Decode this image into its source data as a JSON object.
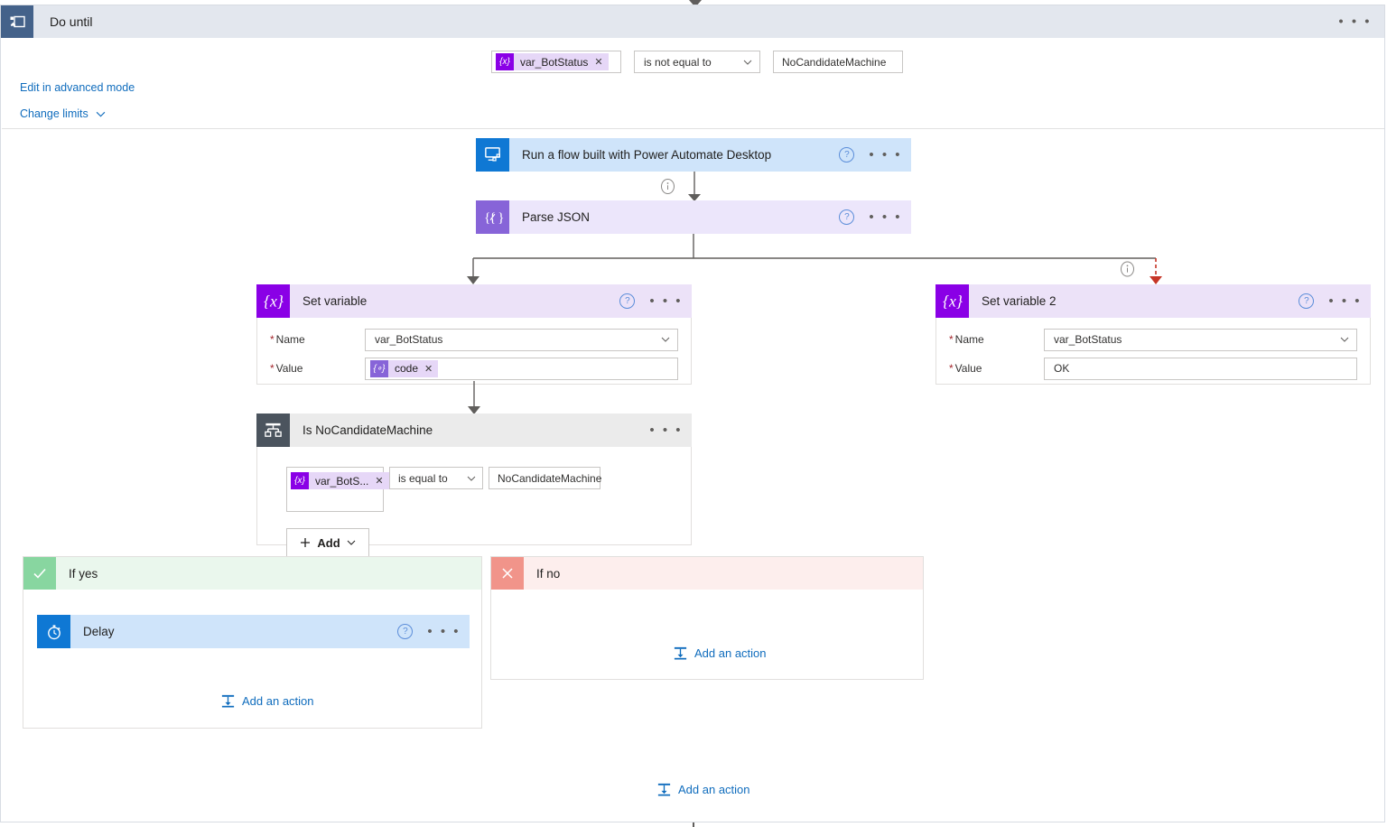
{
  "scope": {
    "title": "Do until",
    "icon": "do-until-icon",
    "menu": "• • •",
    "condition": {
      "token": {
        "label": "var_BotStatus",
        "chip": "{x}",
        "remove": "✕"
      },
      "operator": "is not equal to",
      "value": "NoCandidateMachine"
    },
    "links": {
      "advanced": "Edit in advanced mode",
      "limits": "Change limits"
    }
  },
  "actions": {
    "run_flow": {
      "title": "Run a flow built with Power Automate Desktop",
      "icon": "desktop-flow-icon",
      "help": "?",
      "menu": "• • •"
    },
    "parse_json": {
      "title": "Parse JSON",
      "icon": "expression-icon",
      "help": "?",
      "menu": "• • •"
    },
    "set_variable": {
      "title": "Set variable",
      "icon": "variable-icon",
      "help": "?",
      "menu": "• • •",
      "fields": [
        {
          "label": "Name",
          "required": true,
          "value": "var_BotStatus",
          "type": "dropdown"
        },
        {
          "label": "Value",
          "required": true,
          "value": "",
          "type": "token",
          "token": "code",
          "token_chip": "{∘}",
          "token_remove": "✕"
        }
      ]
    },
    "set_variable_2": {
      "title": "Set variable 2",
      "icon": "variable-icon",
      "help": "?",
      "menu": "• • •",
      "fields": [
        {
          "label": "Name",
          "required": true,
          "value": "var_BotStatus",
          "type": "dropdown"
        },
        {
          "label": "Value",
          "required": true,
          "value": "OK",
          "type": "text"
        }
      ]
    },
    "condition": {
      "title": "Is NoCandidateMachine",
      "icon": "condition-icon",
      "menu": "• • •",
      "row": {
        "token": {
          "label": "var_BotS...",
          "chip": "{x}",
          "remove": "✕"
        },
        "operator": "is equal to",
        "value": "NoCandidateMachine"
      },
      "add_label": "Add"
    },
    "delay": {
      "title": "Delay",
      "icon": "clock-icon",
      "help": "?",
      "menu": "• • •"
    }
  },
  "branches": {
    "yes": {
      "title": "If yes",
      "icon": "check-icon",
      "add_action": "Add an action"
    },
    "no": {
      "title": "If no",
      "icon": "cross-icon",
      "add_action": "Add an action"
    }
  },
  "footer": {
    "add_action": "Add an action"
  },
  "colors": {
    "scope_header": "#e3e7ee",
    "scope_icon": "#44628a",
    "run_flow_header": "#cfe4fa",
    "run_flow_icon": "#0f78d4",
    "parse_json_header": "#ece6fb",
    "parse_json_icon": "#8764d8",
    "set_variable_header": "#ece2f8",
    "set_variable_icon": "#8a00e6",
    "condition_header": "#ebebeb",
    "condition_icon": "#4b545e",
    "delay_header": "#cfe4fa",
    "delay_icon": "#0f78d4",
    "if_yes_header": "#eaf7ed",
    "if_yes_icon": "#88d6a0",
    "if_no_header": "#fdeeed",
    "if_no_icon": "#f1948a",
    "link": "#0f6cbd",
    "connector": "#605e5c",
    "failed_connector": "#c63527",
    "token_purple": "#8a00e6",
    "token_bg": "#e6d7f7"
  }
}
